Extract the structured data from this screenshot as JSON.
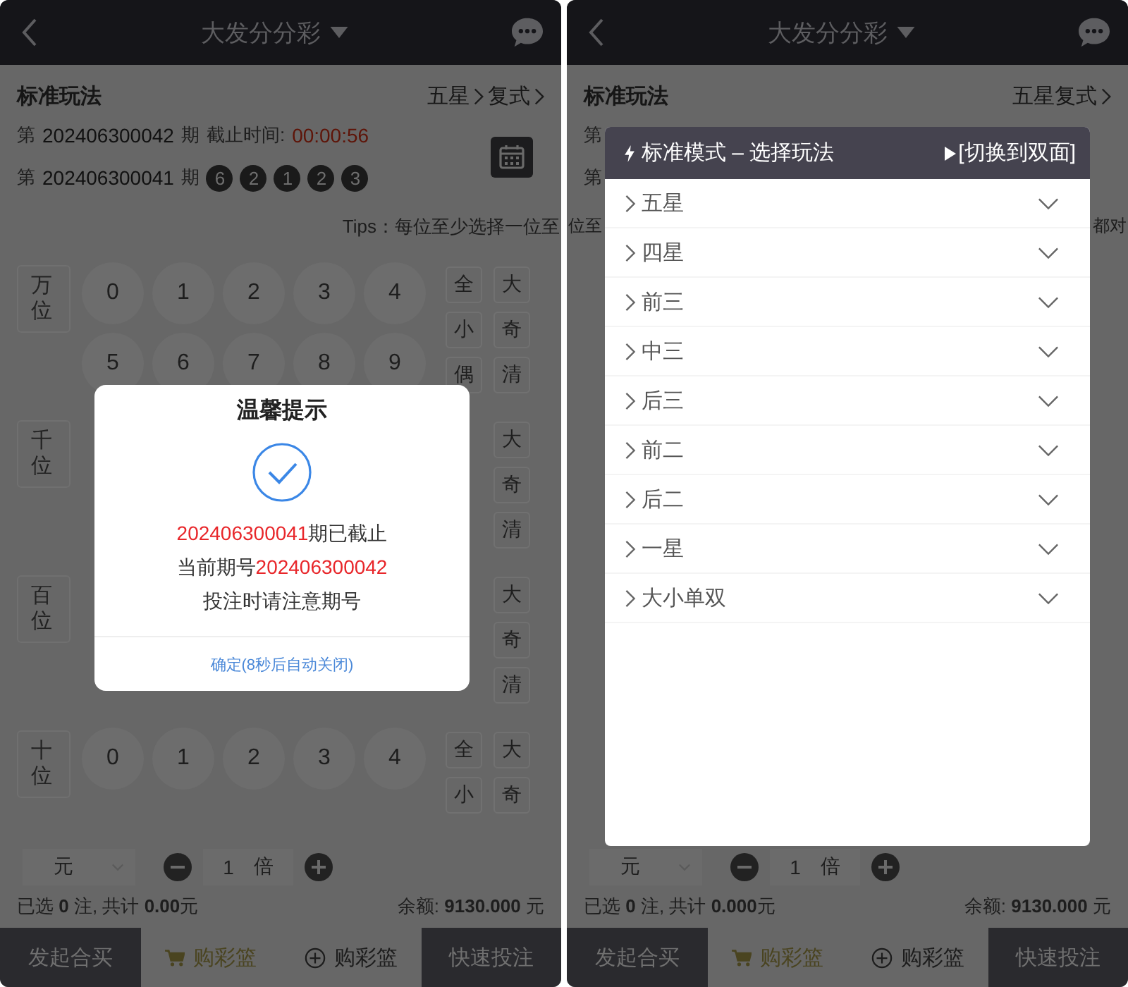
{
  "screens": [
    {
      "header": {
        "title": "大发分分彩"
      },
      "play": {
        "title": "标准玩法",
        "crumbs": [
          "五星",
          "复式"
        ]
      },
      "periods": [
        {
          "prefix": "第",
          "number": "202406300042",
          "suffix": "期",
          "label": "截止时间:",
          "countdown": "00:00:56"
        },
        {
          "prefix": "第",
          "number": "202406300041",
          "suffix": "期",
          "balls": [
            "6",
            "2",
            "1",
            "2",
            "3"
          ]
        }
      ],
      "calendar": true,
      "tips": [
        "Tips：每位至少选择一位至"
      ],
      "positions": [
        {
          "label": "万位",
          "numbers": [
            "0",
            "1",
            "2",
            "3",
            "4",
            "5",
            "6",
            "7",
            "8",
            "9"
          ],
          "quick_left": [
            "全",
            "小",
            "偶"
          ],
          "quick_right": [
            "大",
            "奇",
            "清"
          ]
        },
        {
          "label": "千位",
          "quick_right": [
            "大",
            "奇",
            "清"
          ]
        },
        {
          "label": "百位",
          "quick_right": [
            "大",
            "奇",
            "清"
          ]
        },
        {
          "label": "十位",
          "numbers": [
            "0",
            "1",
            "2",
            "3",
            "4"
          ],
          "quick_left": [
            "全",
            "小"
          ],
          "quick_right": [
            "大",
            "奇"
          ]
        }
      ],
      "bet": {
        "unit": "元",
        "multiplier": "1",
        "multiplier_unit": "倍"
      },
      "summary": {
        "selected": "已选 **0** 注, 共计 **0.00**元",
        "balance": "余额: **9130.000** 元"
      },
      "actions": [
        {
          "kind": "dark",
          "label": "发起合买"
        },
        {
          "kind": "cart",
          "label": "购彩篮"
        },
        {
          "kind": "add",
          "label": "购彩篮"
        },
        {
          "kind": "dark",
          "label": "快速投注"
        }
      ],
      "overlay": {
        "kind": "dialog",
        "title": "温馨提示",
        "lines": [
          [
            {
              "text": "202406300041",
              "highlight": true
            },
            {
              "text": "期已截止",
              "highlight": false
            }
          ],
          [
            {
              "text": "当前期号",
              "highlight": false
            },
            {
              "text": "202406300042",
              "highlight": true
            }
          ],
          [
            {
              "text": "投注时请注意期号",
              "highlight": false
            }
          ]
        ],
        "button": "确定(8秒后自动关闭)"
      }
    },
    {
      "header": {
        "title": "大发分分彩"
      },
      "play": {
        "title": "标准玩法",
        "crumbs": [
          "五星复式"
        ]
      },
      "periods": [
        {
          "prefix": "第"
        },
        {
          "prefix": "第"
        }
      ],
      "tips": [
        "位至",
        "都对"
      ],
      "bet": {
        "unit": "元",
        "multiplier": "1",
        "multiplier_unit": "倍"
      },
      "summary": {
        "selected": "已选 **0** 注, 共计 **0.000**元",
        "balance": "余额: **9130.000** 元"
      },
      "actions": [
        {
          "kind": "dark",
          "label": "发起合买"
        },
        {
          "kind": "cart",
          "label": "购彩篮"
        },
        {
          "kind": "add",
          "label": "购彩篮"
        },
        {
          "kind": "dark",
          "label": "快速投注"
        }
      ],
      "overlay": {
        "kind": "menu",
        "title": "标准模式 – 选择玩法",
        "switch": "[切换到双面]",
        "items": [
          "五星",
          "四星",
          "前三",
          "中三",
          "后三",
          "前二",
          "后二",
          "一星",
          "大小单双"
        ]
      }
    }
  ]
}
